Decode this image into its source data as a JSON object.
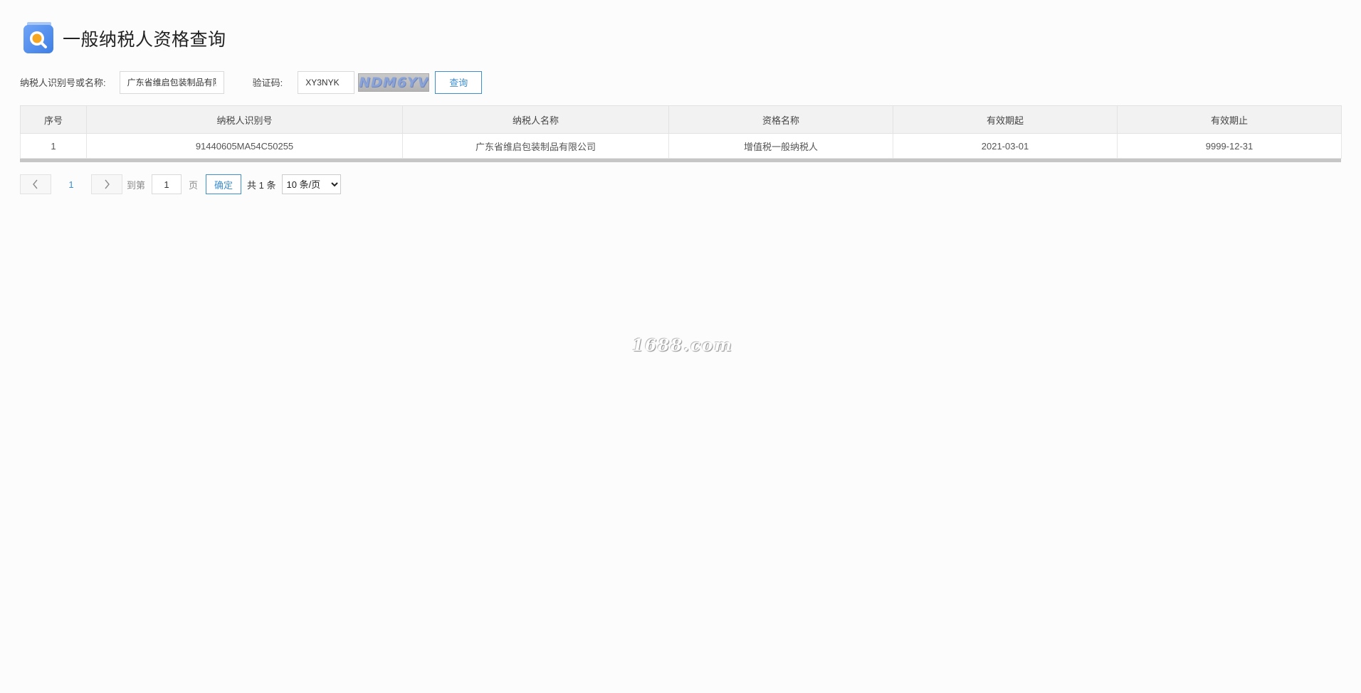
{
  "header": {
    "title": "一般纳税人资格查询",
    "logo_icon": "search-chat-icon"
  },
  "search": {
    "taxpayer_label": "纳税人识别号或名称:",
    "taxpayer_value": "广东省维启包装制品有限",
    "captcha_label": "验证码:",
    "captcha_value": "XY3NYK",
    "captcha_image_text": "NDM6YV",
    "query_label": "查询"
  },
  "table": {
    "columns": [
      "序号",
      "纳税人识别号",
      "纳税人名称",
      "资格名称",
      "有效期起",
      "有效期止"
    ],
    "rows": [
      [
        "1",
        "91440605MA54C50255",
        "广东省维启包装制品有限公司",
        "增值税一般纳税人",
        "2021-03-01",
        "9999-12-31"
      ]
    ]
  },
  "pagination": {
    "prev_icon": "chevron-left-icon",
    "next_icon": "chevron-right-icon",
    "current_page": "1",
    "goto_label": "到第",
    "goto_value": "1",
    "page_unit": "页",
    "confirm_label": "确定",
    "total_text": "共 1 条",
    "page_size_selected": "10 条/页"
  },
  "watermark": {
    "text": "1688.com"
  },
  "colors": {
    "accent": "#3e8ed0",
    "logo_blue": "#4f8ff0",
    "logo_orange": "#f5a623",
    "header_bg": "#f2f2f2"
  }
}
